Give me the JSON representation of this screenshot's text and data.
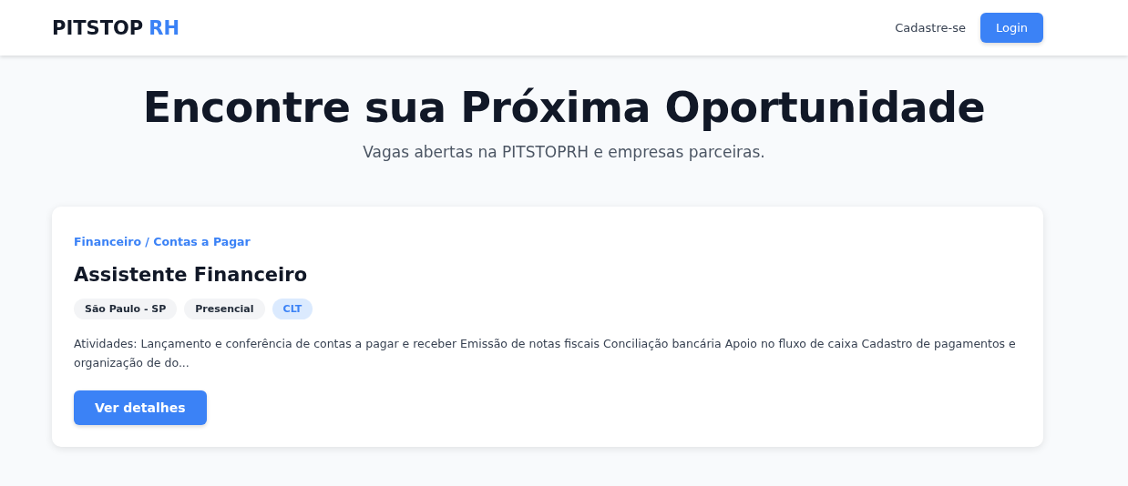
{
  "header": {
    "logo": {
      "text": "PITSTOP",
      "accent": "RH"
    },
    "links": [
      {
        "label": "Cadastre-se",
        "kind": "link"
      },
      {
        "label": "Login",
        "kind": "button"
      }
    ]
  },
  "hero": {
    "title": "Encontre sua Próxima Oportunidade",
    "subtitle": "Vagas abertas na PITSTOPRH e empresas parceiras."
  },
  "jobs": [
    {
      "category": "Financeiro / Contas a Pagar",
      "title": "Assistente Financeiro",
      "tags": [
        {
          "label": "São Paulo - SP",
          "kind": "neutral"
        },
        {
          "label": "Presencial",
          "kind": "neutral"
        },
        {
          "label": "CLT",
          "kind": "accent"
        }
      ],
      "description": "Atividades: Lançamento e conferência de contas a pagar e receber Emissão de notas fiscais Conciliação bancária Apoio no fluxo de caixa Cadastro de pagamentos e organização de do...",
      "action": "Ver detalhes"
    }
  ]
}
